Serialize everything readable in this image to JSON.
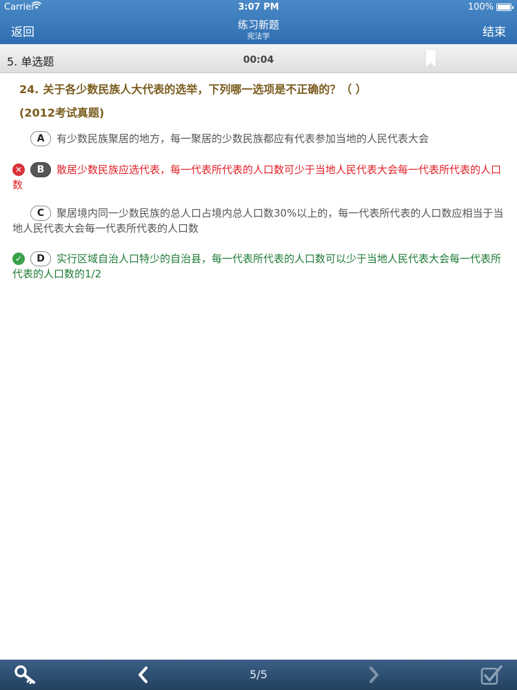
{
  "status_bar": {
    "carrier": "Carrier",
    "wifi_icon": "wifi-icon",
    "time": "3:07 PM",
    "battery": "100%",
    "battery_icon": "battery-icon"
  },
  "nav": {
    "back_label": "返回",
    "title": "练习新题",
    "subtitle": "宪法学",
    "end_label": "结束"
  },
  "section": {
    "label": "5. 单选题",
    "timer": "00:04",
    "bookmark_icon": "bookmark-icon"
  },
  "question": {
    "number": "24",
    "separator": ".",
    "text": "关于各少数民族人大代表的选举，下列哪一选项是不正确的？（ ）",
    "source": "(2012考试真题)"
  },
  "options": [
    {
      "letter": "A",
      "text": "有少数民族聚居的地方，每一聚居的少数民族都应有代表参加当地的人民代表大会",
      "state": "normal"
    },
    {
      "letter": "B",
      "text": "散居少数民族应选代表，每一代表所代表的人口数可少于当地人民代表大会每一代表所代表的人口数",
      "state": "wrong-selected"
    },
    {
      "letter": "C",
      "text": "聚居境内同一少数民族的总人口占境内总人口数30%以上的，每一代表所代表的人口数应相当于当地人民代表大会每一代表所代表的人口数",
      "state": "normal"
    },
    {
      "letter": "D",
      "text": "实行区域自治人口特少的自治县，每一代表所代表的人口数可以少于当地人民代表大会每一代表所代表的人口数的1/2",
      "state": "correct"
    }
  ],
  "toolbar": {
    "key_icon": "key-icon",
    "prev_icon": "chevron-left-icon",
    "page": "5/5",
    "next_icon": "chevron-right-icon",
    "submit_icon": "checkbox-check-icon"
  },
  "colors": {
    "nav_blue": "#3a7cbf",
    "question_brown": "#7a5c1e",
    "wrong_red": "#e01f27",
    "correct_green": "#1e7a36",
    "toolbar_navy": "#2c4b6e"
  }
}
